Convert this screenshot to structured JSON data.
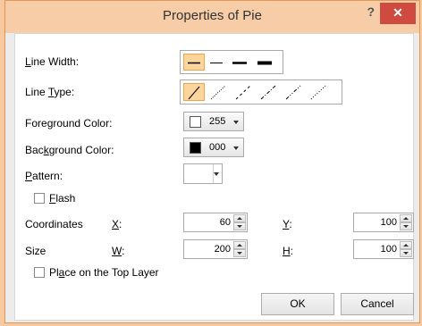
{
  "window": {
    "title": "Properties of Pie",
    "help_label": "?",
    "close_label": "✕"
  },
  "line_width": {
    "label_pre": "",
    "label_u": "L",
    "label_post": "ine Width:",
    "options": [
      "thin",
      "medium",
      "thick",
      "extra-thick"
    ],
    "selected_index": 0
  },
  "line_type": {
    "label_pre": "Line ",
    "label_u": "T",
    "label_post": "ype:",
    "options": [
      "solid",
      "dotted",
      "dashed",
      "dash-dot",
      "dash-dot-dot",
      "fine-dot"
    ],
    "selected_index": 0
  },
  "foreground": {
    "label_pre": "Fore",
    "label_u": "g",
    "label_post": "round Color:",
    "value": "255",
    "swatch_color": "#ffffff"
  },
  "background": {
    "label_pre": "Bac",
    "label_u": "k",
    "label_post": "ground Color:",
    "value": "000",
    "swatch_color": "#000000"
  },
  "pattern": {
    "label_pre": "",
    "label_u": "P",
    "label_post": "attern:"
  },
  "flash": {
    "label_pre": "",
    "label_u": "F",
    "label_post": "lash",
    "checked": false
  },
  "coordinates": {
    "label": "Coordinates",
    "x_label_u": "X",
    "x_label_post": ":",
    "x_value": "60",
    "y_label_u": "Y",
    "y_label_post": ":",
    "y_value": "100"
  },
  "size": {
    "label": "Size",
    "w_label_u": "W",
    "w_label_post": ":",
    "w_value": "200",
    "h_label_u": "H",
    "h_label_post": ":",
    "h_value": "100"
  },
  "top_layer": {
    "label_pre": "Pl",
    "label_u": "a",
    "label_post": "ce on the Top Layer",
    "checked": false
  },
  "buttons": {
    "ok": "OK",
    "cancel": "Cancel"
  },
  "colors": {
    "accent": "#e59655",
    "close": "#cf4a3f",
    "selection": "#fbd59b"
  }
}
